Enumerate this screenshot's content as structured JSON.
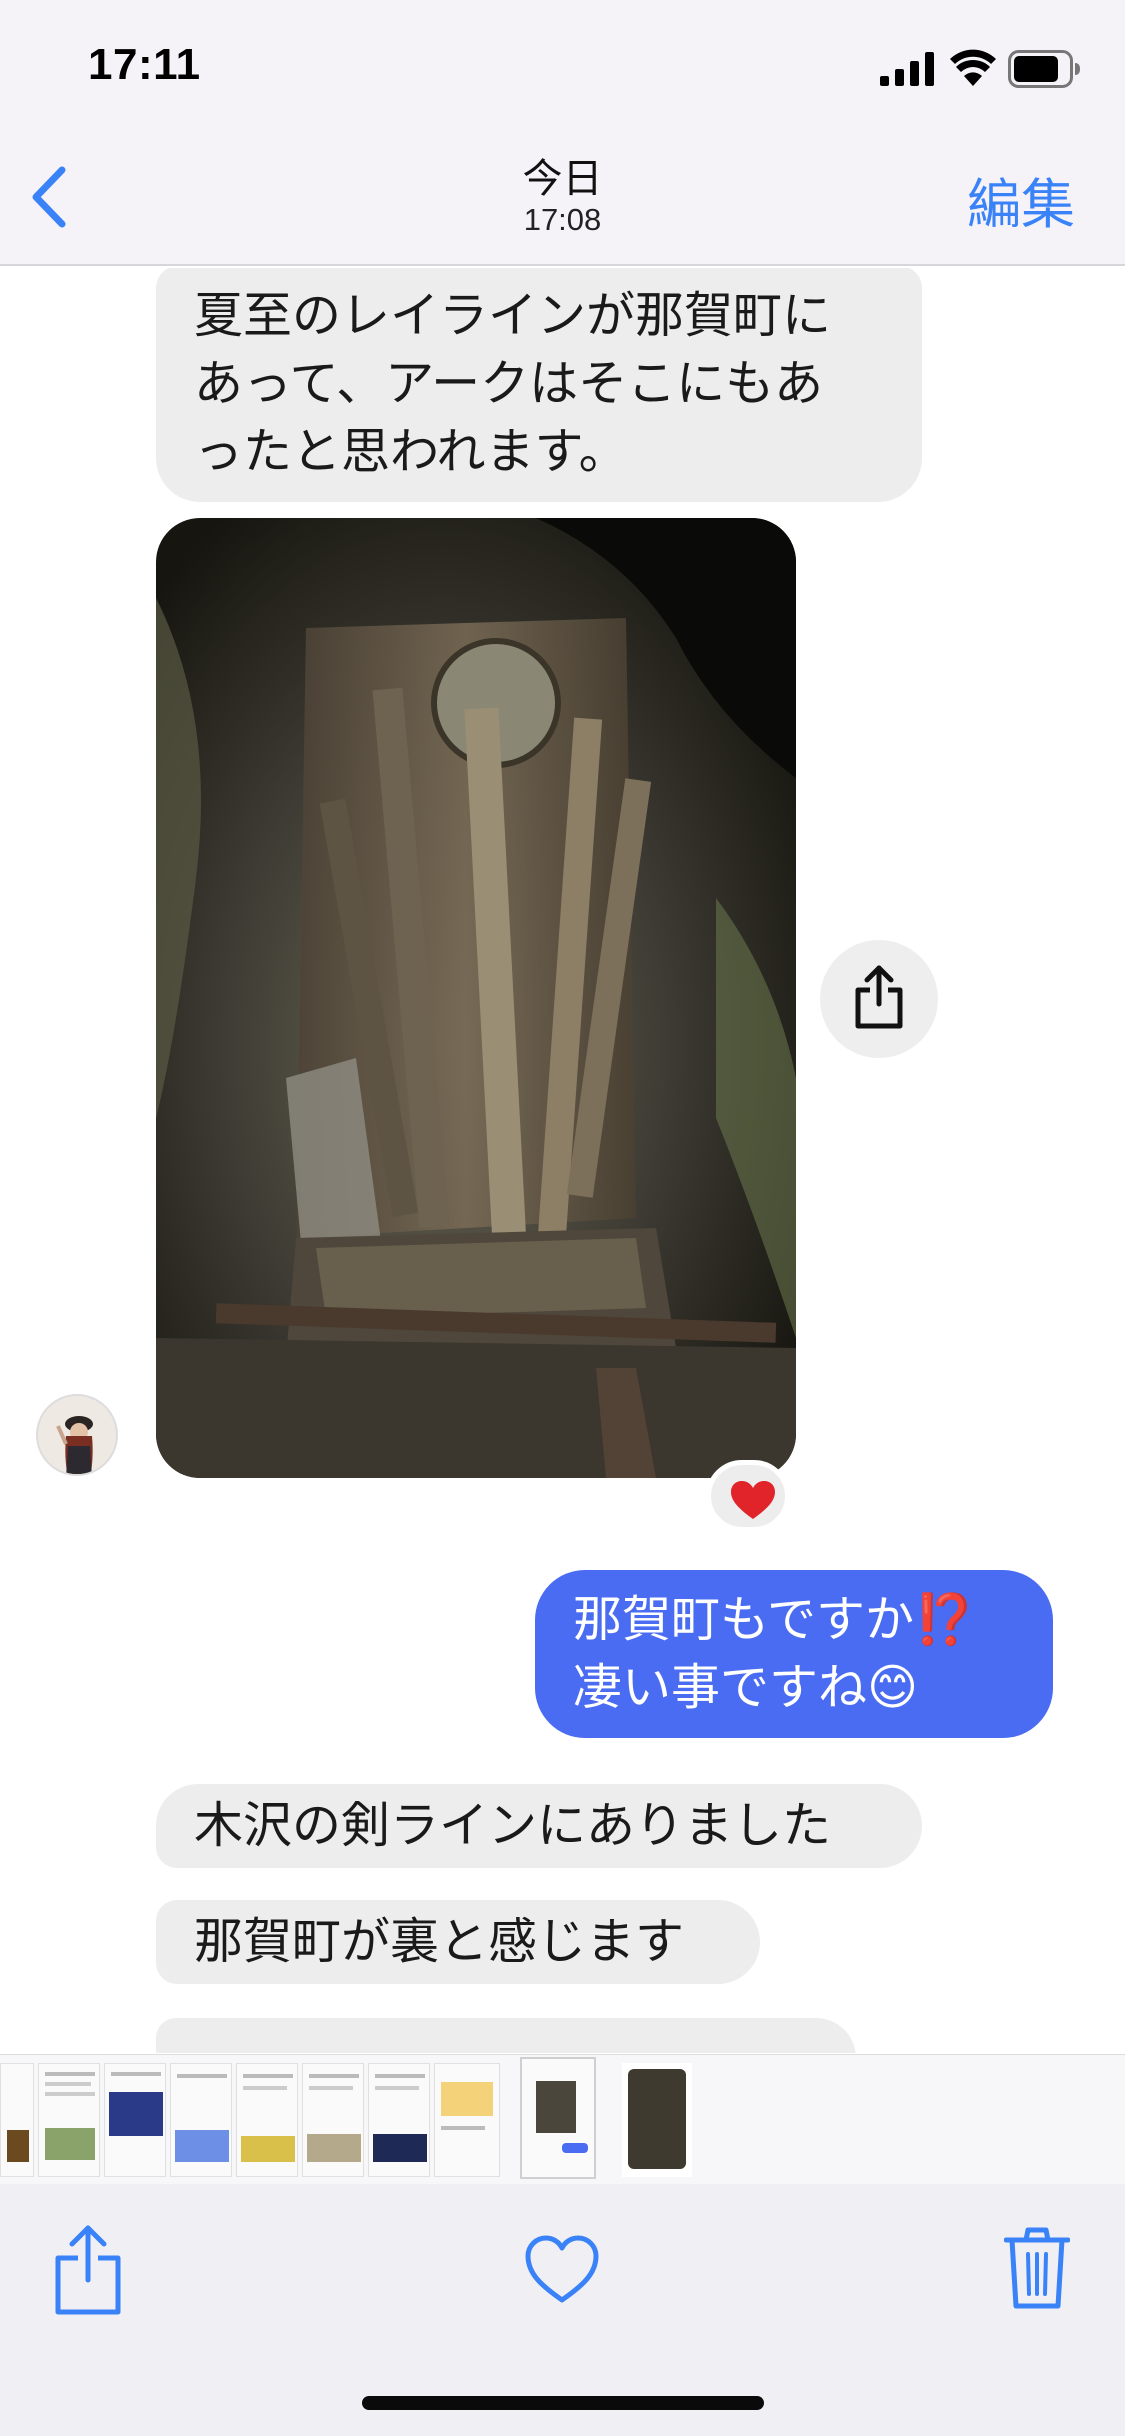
{
  "status_bar": {
    "time": "17:11",
    "icons": [
      "signal-icon",
      "wifi-icon",
      "battery-icon"
    ]
  },
  "nav": {
    "title": "今日",
    "subtitle": "17:08",
    "edit_label": "編集",
    "back_icon": "chevron-left-icon"
  },
  "messages": [
    {
      "direction": "incoming",
      "lines": [
        "夏至のレイラインが那賀町に",
        "あって、アークはそこにもあ",
        "ったと思われます。"
      ]
    },
    {
      "direction": "incoming",
      "type": "photo",
      "reaction": "heart"
    },
    {
      "direction": "outgoing",
      "lines": [
        "那賀町もですか⁉️",
        "凄い事ですね😊"
      ]
    },
    {
      "direction": "incoming",
      "lines": [
        "木沢の剣ラインにありました"
      ]
    },
    {
      "direction": "incoming",
      "lines": [
        "那賀町が裏と感じます"
      ]
    }
  ],
  "toolbar": {
    "share_icon": "share-icon",
    "favorite_icon": "heart-outline-icon",
    "delete_icon": "trash-icon"
  },
  "colors": {
    "accent": "#3a82f7",
    "outgoing_bubble": "#4a6cf2",
    "incoming_bubble": "#ededed",
    "reaction_heart": "#e0242a"
  }
}
